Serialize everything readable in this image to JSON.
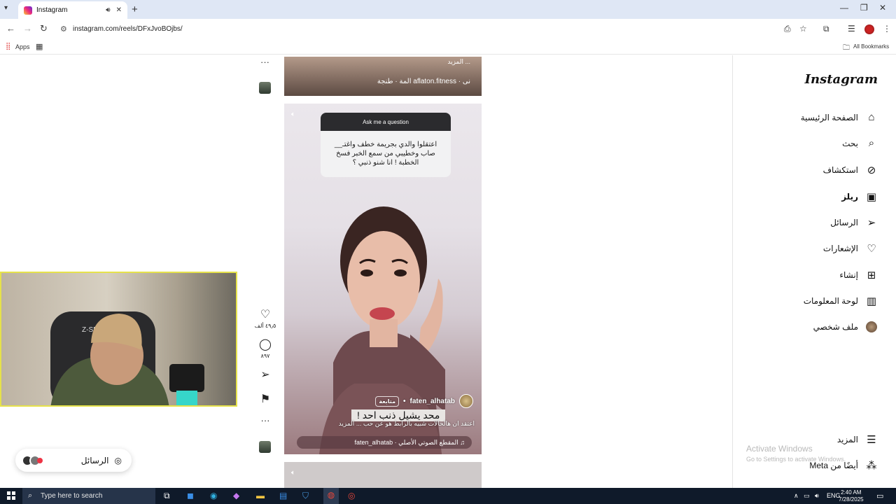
{
  "browser": {
    "tab_title": "Instagram",
    "tab_audio_icon": "speaker-icon",
    "tab_close_icon": "close-icon",
    "new_tab_icon": "plus-icon",
    "url": "instagram.com/reels/DFxJvoBOjbs/",
    "bookmarks_bar": {
      "apps_label": "Apps",
      "all_bookmarks_label": "All Bookmarks"
    }
  },
  "feed": {
    "reel1": {
      "more_text": "... المزيد",
      "info": "نى · aflaton.fitness  المة  ·  طنجة"
    },
    "reel1_more_dots": "···",
    "question_card": {
      "header": "Ask me a question",
      "text": "اعتقلوا والدي بجريمة خطف واغتـ__ صاب وخطيبي من سمع الخبر فسخ الخطبة ! انا شنو ذنبي ؟"
    },
    "reel2": {
      "username": "faten_alhatab",
      "follow_label": "متابعة",
      "subtitle": "محد يشيل ذنب احد !",
      "description": "اعتقد ان هالحالات شبيه بالرابط هو عن حب ... المزيد",
      "audio": "المقطع الصوتي الأصلي · faten_alhatab"
    },
    "actions": {
      "likes": "٤٩٫٥ ألف",
      "comments": "٨٩٧",
      "more_dots": "···"
    }
  },
  "messages_pill": {
    "label": "الرسائل"
  },
  "sidebar": {
    "logo": "Instagram",
    "items": [
      {
        "label": "الصفحة الرئيسية",
        "icon": "home-icon"
      },
      {
        "label": "بحث",
        "icon": "search-icon"
      },
      {
        "label": "استكشاف",
        "icon": "compass-icon"
      },
      {
        "label": "ريلز",
        "icon": "reels-icon"
      },
      {
        "label": "الرسائل",
        "icon": "send-icon"
      },
      {
        "label": "الإشعارات",
        "icon": "heart-icon"
      },
      {
        "label": "إنشاء",
        "icon": "create-icon"
      },
      {
        "label": "لوحة المعلومات",
        "icon": "dashboard-icon"
      },
      {
        "label": "ملف شخصي",
        "icon": "avatar"
      }
    ],
    "more_label": "المزيد",
    "meta_label": "أيضًا من Meta"
  },
  "watermark": {
    "title": "Activate Windows",
    "subtitle": "Go to Settings to activate Windows."
  },
  "taskbar": {
    "search_placeholder": "Type here to search",
    "lang": "ENG",
    "time": "2:40 AM",
    "date": "7/28/2025"
  }
}
